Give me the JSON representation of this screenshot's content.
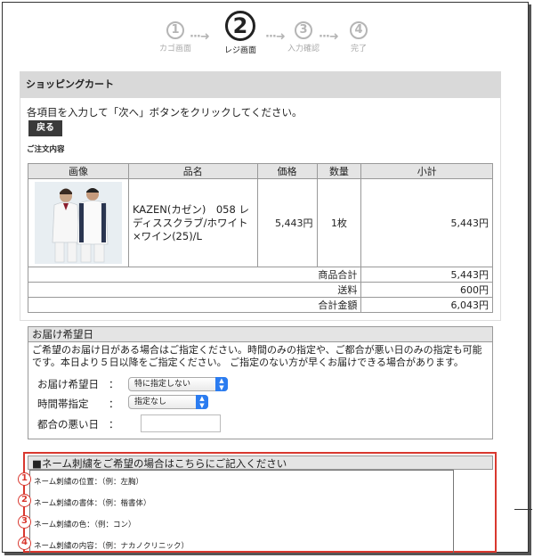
{
  "steps": [
    {
      "num": "1",
      "label": "カゴ画面",
      "active": false
    },
    {
      "num": "2",
      "label": "レジ画面",
      "active": true
    },
    {
      "num": "3",
      "label": "入力確認",
      "active": false
    },
    {
      "num": "4",
      "label": "完了",
      "active": false
    }
  ],
  "arrow": "···➜",
  "cart": {
    "title": "ショッピングカート",
    "instruction": "各項目を入力して「次へ」ボタンをクリックしてください。",
    "back_label": "戻る",
    "order_label": "ご注文内容"
  },
  "table": {
    "headers": [
      "画像",
      "品名",
      "価格",
      "数量",
      "小計"
    ],
    "item": {
      "name": "KAZEN(カゼン)　058 レディススクラブ/ホワイト×ワイン(25)/L",
      "price": "5,443円",
      "qty": "1枚",
      "subtotal": "5,443円"
    },
    "totals": [
      {
        "label": "商品合計",
        "value": "5,443円"
      },
      {
        "label": "送料",
        "value": "600円"
      },
      {
        "label": "合計金額",
        "value": "6,043円"
      }
    ]
  },
  "delivery": {
    "title": "お届け希望日",
    "text": "ご希望のお届け日がある場合はご指定ください。時間のみの指定や、ご都合が悪い日のみの指定も可能です。本日より５日以降をご指定ください。 ご指定のない方が早くお届けできる場合があります。",
    "fields": {
      "date_label": "お届け希望日",
      "date_value": "特に指定しない",
      "time_label": "時間帯指定",
      "time_value": "指定なし",
      "bad_label": "都合の悪い日",
      "colon": "："
    }
  },
  "embroidery": {
    "title": "■ネーム刺繍をご希望の場合はこちらにご記入ください",
    "lines": [
      {
        "num": "1",
        "text": "ネーム刺繍の位置：（例：左胸）"
      },
      {
        "num": "2",
        "text": "ネーム刺繍の書体：（例：楷書体）"
      },
      {
        "num": "3",
        "text": "ネーム刺繍の色：（例：コン）"
      },
      {
        "num": "4",
        "text": "ネーム刺繍の内容：（例：ナカノクリニック）"
      }
    ]
  },
  "colors": {
    "accent_red": "#d9382f",
    "select_blue": "#2b7cf0",
    "header_gray": "#d9d9d9"
  }
}
